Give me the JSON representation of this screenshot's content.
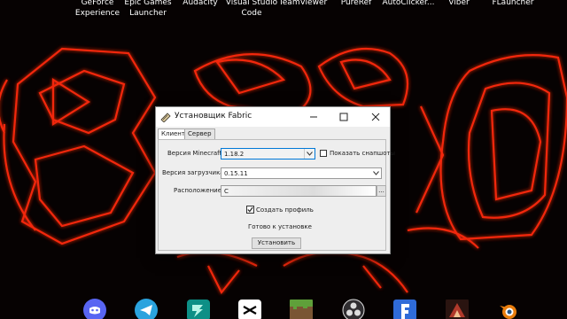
{
  "desktop": {
    "icons": [
      {
        "label": "GeForce\nExperience"
      },
      {
        "label": "Epic Games\nLauncher"
      },
      {
        "label": "Audacity"
      },
      {
        "label": "Visual Studio\nCode"
      },
      {
        "label": "TeamViewer"
      },
      {
        "label": "PureRef"
      },
      {
        "label": "AutoClicker..."
      },
      {
        "label": "Viber"
      },
      {
        "label": "FLauncher"
      }
    ]
  },
  "dock": {
    "icons": [
      {
        "name": "discord-icon",
        "color": "#5865f2"
      },
      {
        "name": "telegram-icon",
        "color": "#2aa3de"
      },
      {
        "name": "filmora-icon",
        "color": "#12b5a0"
      },
      {
        "name": "capcut-icon",
        "color": "#ffffff"
      },
      {
        "name": "minecraft-icon",
        "color": "#6aa84f"
      },
      {
        "name": "obs-icon",
        "color": "#302e31"
      },
      {
        "name": "fortnite-icon",
        "color": "#2f6bd8"
      },
      {
        "name": "game-icon",
        "color": "#b0392b"
      },
      {
        "name": "blender-icon",
        "color": "#e87d0d"
      }
    ]
  },
  "window": {
    "title": "Установщик Fabric",
    "tabs": [
      {
        "label": "Клиент"
      },
      {
        "label": "Сервер"
      }
    ],
    "minecraft_version_label": "Версия Minecraft:",
    "minecraft_version_value": "1.18.2",
    "show_snapshots_label": "Показать снапшоты",
    "loader_version_label": "Версия загрузчика:",
    "loader_version_value": "0.15.11",
    "location_label": "Расположение:",
    "location_value": "C",
    "browse_label": "...",
    "create_profile_label": "Создать профиль",
    "status_text": "Готово к установке",
    "install_label": "Установить"
  },
  "colors": {
    "neon": "#ff2a10",
    "neon_glow": "#8a0d04"
  }
}
